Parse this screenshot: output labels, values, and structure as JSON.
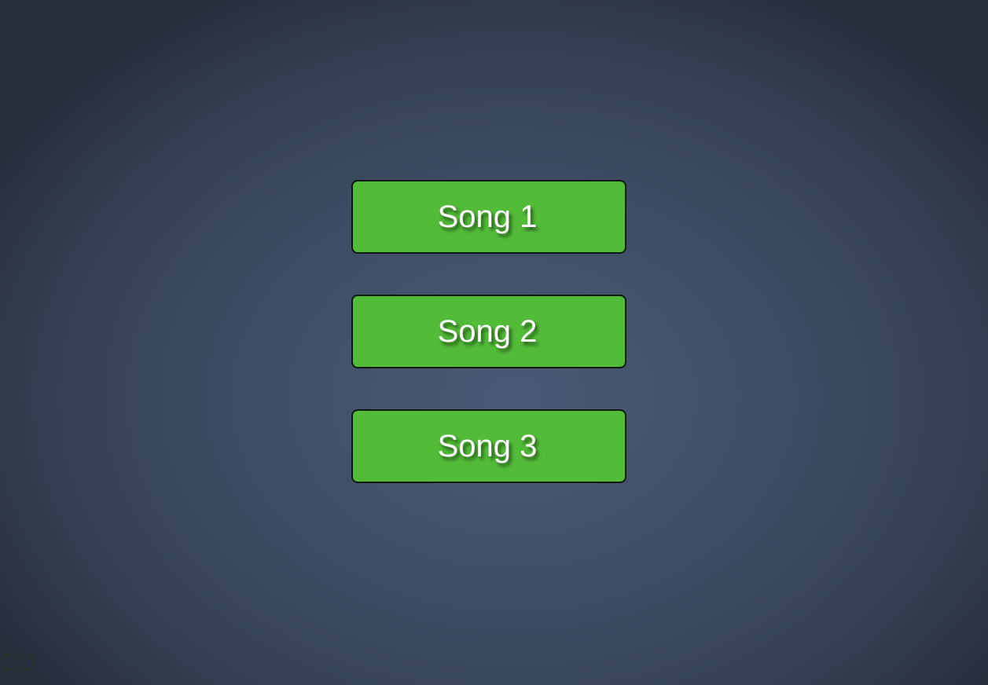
{
  "songs": [
    {
      "label": "Song 1"
    },
    {
      "label": "Song 2"
    },
    {
      "label": "Song 3"
    }
  ],
  "back_button": {
    "icon": "back-arrow-icon"
  },
  "colors": {
    "button_fill": "#52bb38",
    "button_border": "#0f1a0c",
    "label": "#ffffff",
    "background_center": "#485a76",
    "background_edge": "#252d3a",
    "back_icon_stroke": "#2a2c2a"
  }
}
